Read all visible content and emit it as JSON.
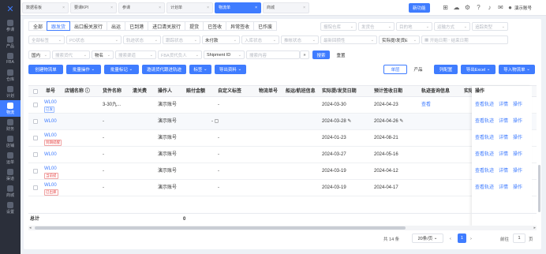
{
  "sidebar": {
    "items": [
      {
        "label": "参课"
      },
      {
        "label": "产品"
      },
      {
        "label": "FBA"
      },
      {
        "label": "仓库"
      },
      {
        "label": "计划"
      },
      {
        "label": "物流"
      },
      {
        "label": "财务"
      },
      {
        "label": "店铺"
      },
      {
        "label": "运单"
      },
      {
        "label": "渠道"
      },
      {
        "label": "商城"
      },
      {
        "label": "设置"
      }
    ]
  },
  "topbar": {
    "tabs": [
      {
        "label": "数据看板"
      },
      {
        "label": "要课KPI"
      },
      {
        "label": "参课"
      },
      {
        "label": "计划单"
      },
      {
        "label": "物流单"
      },
      {
        "label": "商城"
      }
    ],
    "new_function": "新功能",
    "username": "演示账号"
  },
  "status_tabs": [
    "全部",
    "跟发货",
    "出口报关放行",
    "出运",
    "已到港",
    "进口清关放行",
    "提货",
    "已签收",
    "异常签收",
    "已作废"
  ],
  "filters": {
    "row1": [
      "报院仓库",
      "发货仓",
      "目的地",
      "运输方式",
      "追踪类型"
    ],
    "row2": [
      "全部标签",
      "PO状态",
      "轨迹状态",
      "跟踪状态",
      "未付款",
      "入库状态",
      "推帐状态",
      "最新回攒性"
    ],
    "date_type": "实际提/发货E",
    "date_start": "开始日期",
    "date_sep": "-",
    "date_end": "结束日期",
    "row3": [
      "国内",
      "搜索货代",
      "物名",
      "搜索渠道",
      "FBA货代负人"
    ],
    "search_type": "Shipment ID",
    "search_placeholder": "搜索内容",
    "search_button": "搜索",
    "reset_button": "重置"
  },
  "actions": {
    "create": "创建物流单",
    "batch_op": "批量操作",
    "batch_mark": "批量标记",
    "invite": "邀请货代跟进轨迹",
    "tag": "标签",
    "export_data": "导出资料",
    "view_single": "单层",
    "view_product": "产品",
    "col_config": "列配置",
    "export_excel": "导出Excel",
    "import": "导入物流单"
  },
  "table": {
    "headers": [
      "单号",
      "店铺名称",
      "货件名称",
      "清关费",
      "操作人",
      "赔付金额",
      "自定义标签",
      "物流单号",
      "船运/航班信息",
      "实际提/发货日期",
      "预计签收日期",
      "轨迹查询信息",
      "实际"
    ],
    "ops_header": "操作",
    "rows": [
      {
        "order": "WL00",
        "badge": "已发",
        "badge_color": "blue",
        "shipment": "3-30九...",
        "operator": "演示账号",
        "tag": "-",
        "ship_date": "2024-03-30",
        "eta": "2024-04-23",
        "track": "查看",
        "alt": false
      },
      {
        "order": "WL00",
        "badge": "",
        "badge_color": "",
        "shipment": "-",
        "operator": "演示账号",
        "tag": "- ▢",
        "ship_date": "2024-03-28",
        "eta": "2024-04-26",
        "track": "",
        "alt": true
      },
      {
        "order": "WL00",
        "badge": "到期提醒",
        "badge_color": "red",
        "shipment": "-",
        "operator": "演示账号",
        "tag": "-",
        "ship_date": "2024-01-23",
        "eta": "2024-08-21",
        "track": "",
        "alt": false
      },
      {
        "order": "WL00",
        "badge": "",
        "badge_color": "",
        "shipment": "-",
        "operator": "演示账号",
        "tag": "-",
        "ship_date": "2024-03-27",
        "eta": "2024-05-16",
        "track": "",
        "alt": false
      },
      {
        "order": "WL00",
        "badge": "当前提",
        "badge_color": "red",
        "shipment": "-",
        "operator": "演示账号",
        "tag": "-",
        "ship_date": "2024-03-19",
        "eta": "2024-04-12",
        "track": "",
        "alt": false
      },
      {
        "order": "WL00",
        "badge": "已出库",
        "badge_color": "red",
        "shipment": "-",
        "operator": "演示账号",
        "tag": "-",
        "ship_date": "2024-03-19",
        "eta": "2024-04-17",
        "track": "",
        "alt": false
      }
    ],
    "ops": [
      "查看轨迹",
      "详情",
      "操作"
    ],
    "total_label": "总计",
    "total_value": "0"
  },
  "pager": {
    "total": "共 14 条",
    "page_size": "20条/页",
    "goto": "前往",
    "page": "1",
    "page_unit": "页",
    "current": "1"
  }
}
